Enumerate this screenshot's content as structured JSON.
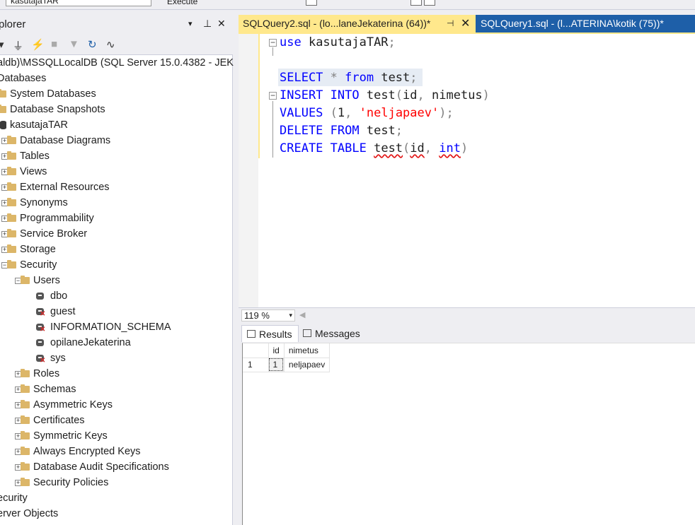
{
  "toolbar": {
    "database": "kasutajaTAR",
    "execute_label": "Execute"
  },
  "explorer": {
    "title": "plorer",
    "header_buttons": [
      "▾",
      "⊥",
      "✕"
    ],
    "tree": [
      {
        "label": "aldb)\\MSSQLLocalDB (SQL Server 15.0.4382 - JEK",
        "level": -1,
        "icon": "server",
        "expander": ""
      },
      {
        "label": "Databases",
        "level": -1,
        "icon": "none",
        "expander": ""
      },
      {
        "label": "System Databases",
        "level": 0,
        "icon": "folder",
        "expander": ""
      },
      {
        "label": "Database Snapshots",
        "level": 0,
        "icon": "folder",
        "expander": ""
      },
      {
        "label": "kasutajaTAR",
        "level": 0,
        "icon": "database",
        "expander": ""
      },
      {
        "label": "Database Diagrams",
        "level": 1,
        "icon": "folder",
        "expander": "+"
      },
      {
        "label": "Tables",
        "level": 1,
        "icon": "folder",
        "expander": "+"
      },
      {
        "label": "Views",
        "level": 1,
        "icon": "folder",
        "expander": "+"
      },
      {
        "label": "External Resources",
        "level": 1,
        "icon": "folder",
        "expander": "+"
      },
      {
        "label": "Synonyms",
        "level": 1,
        "icon": "folder",
        "expander": "+"
      },
      {
        "label": "Programmability",
        "level": 1,
        "icon": "folder",
        "expander": "+"
      },
      {
        "label": "Service Broker",
        "level": 1,
        "icon": "folder",
        "expander": "+"
      },
      {
        "label": "Storage",
        "level": 1,
        "icon": "folder",
        "expander": "+"
      },
      {
        "label": "Security",
        "level": 1,
        "icon": "folder",
        "expander": "−"
      },
      {
        "label": "Users",
        "level": 2,
        "icon": "folder",
        "expander": "−"
      },
      {
        "label": "dbo",
        "level": 3,
        "icon": "user",
        "expander": ""
      },
      {
        "label": "guest",
        "level": 3,
        "icon": "user-x",
        "expander": ""
      },
      {
        "label": "INFORMATION_SCHEMA",
        "level": 3,
        "icon": "user-x",
        "expander": ""
      },
      {
        "label": "opilaneJekaterina",
        "level": 3,
        "icon": "user",
        "expander": ""
      },
      {
        "label": "sys",
        "level": 3,
        "icon": "user-x",
        "expander": ""
      },
      {
        "label": "Roles",
        "level": 2,
        "icon": "folder",
        "expander": "+"
      },
      {
        "label": "Schemas",
        "level": 2,
        "icon": "folder",
        "expander": "+"
      },
      {
        "label": "Asymmetric Keys",
        "level": 2,
        "icon": "folder",
        "expander": "+"
      },
      {
        "label": "Certificates",
        "level": 2,
        "icon": "folder",
        "expander": "+"
      },
      {
        "label": "Symmetric Keys",
        "level": 2,
        "icon": "folder",
        "expander": "+"
      },
      {
        "label": "Always Encrypted Keys",
        "level": 2,
        "icon": "folder",
        "expander": "+"
      },
      {
        "label": "Database Audit Specifications",
        "level": 2,
        "icon": "folder",
        "expander": "+"
      },
      {
        "label": "Security Policies",
        "level": 2,
        "icon": "folder",
        "expander": "+"
      },
      {
        "label": "ecurity",
        "level": -1,
        "icon": "none",
        "expander": ""
      },
      {
        "label": "erver Objects",
        "level": -1,
        "icon": "none",
        "expander": ""
      }
    ]
  },
  "tabs": {
    "active": "SQLQuery2.sql - (lo...laneJekaterina (64))*",
    "other": "SQLQuery1.sql - (l...ATERINA\\kotik (75))*",
    "pin_icon": "⊣",
    "close_icon": "✕"
  },
  "editor": {
    "lines": [
      {
        "fold": "−",
        "tokens": [
          [
            "kw",
            "use"
          ],
          [
            "id",
            " kasutajaTAR"
          ],
          [
            "op",
            ";"
          ]
        ]
      },
      {
        "fold": "",
        "tokens": []
      },
      {
        "fold": "",
        "tokens": [
          [
            "kw",
            "SELECT"
          ],
          [
            "op",
            " *"
          ],
          [
            "kw",
            " from"
          ],
          [
            "id",
            " test"
          ],
          [
            "op",
            ";"
          ]
        ]
      },
      {
        "fold": "−",
        "tokens": [
          [
            "kw",
            "INSERT"
          ],
          [
            "kw",
            " INTO"
          ],
          [
            "id",
            " test"
          ],
          [
            "op",
            "("
          ],
          [
            "id",
            "id"
          ],
          [
            "op",
            ","
          ],
          [
            "id",
            " nimetus"
          ],
          [
            "op",
            ")"
          ]
        ]
      },
      {
        "fold": "",
        "tokens": [
          [
            "kw",
            "VALUES"
          ],
          [
            "op",
            " ("
          ],
          [
            "id",
            "1"
          ],
          [
            "op",
            ","
          ],
          [
            "str",
            " 'neljapaev'"
          ],
          [
            "op",
            ");"
          ]
        ]
      },
      {
        "fold": "",
        "tokens": [
          [
            "kw",
            "DELETE"
          ],
          [
            "kw",
            " FROM"
          ],
          [
            "id",
            " test"
          ],
          [
            "op",
            ";"
          ]
        ]
      },
      {
        "fold": "",
        "tokens": [
          [
            "kw",
            "CREATE"
          ],
          [
            "kw",
            " TABLE"
          ],
          [
            "id",
            " "
          ],
          [
            "idsq",
            "test"
          ],
          [
            "op",
            "("
          ],
          [
            "idsq",
            "id"
          ],
          [
            "op",
            ","
          ],
          [
            "id",
            " "
          ],
          [
            "kwsq",
            "int"
          ],
          [
            "op",
            ")"
          ]
        ]
      }
    ]
  },
  "zoom": {
    "value": "119 %",
    "arrow": "▾"
  },
  "results": {
    "tab_results": "Results",
    "tab_messages": "Messages",
    "columns": [
      "id",
      "nimetus"
    ],
    "rows": [
      {
        "num": "1",
        "cells": [
          "1",
          "neljapaev"
        ]
      }
    ]
  }
}
